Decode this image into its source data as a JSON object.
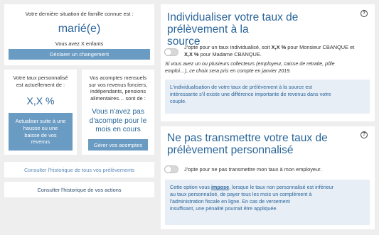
{
  "family": {
    "heading": "Votre dernière situation de famille connue est :",
    "status": "marié(e)",
    "children": "Vous avez X enfants",
    "declare_button": "Déclarer un changement"
  },
  "rate": {
    "heading_line1": "Votre taux personnalisé",
    "heading_line2": "est actuellement de :",
    "value": "X,X %",
    "button_line1": "Actualiser suite à une",
    "button_line2": "hausse ou une",
    "button_line3": "baisse de vos",
    "button_line4": "revenus"
  },
  "installments": {
    "heading_line1": "Vos acomptes mensuels",
    "heading_line2": "sur vos revenus fonciers,",
    "heading_line3": "indépendants, pensions",
    "heading_line4": "alimentaires… sont de :",
    "message_line1": "Vous n'avez pas",
    "message_line2": "d'acompte pour le",
    "message_line3": "mois en cours",
    "button": "Gérer vos acomptes"
  },
  "links": {
    "history_withholding": "Consulter l'historique de tous vos prélèvements",
    "history_actions": "Consulter l'historique de vos actions"
  },
  "individualize": {
    "title_line1": "Individualiser votre taux de prélèvement à la",
    "title_line2": "source",
    "help": "?",
    "option_pre": "J'opte pour un taux individualisé, soit ",
    "rate1": "X,X %",
    "option_mid": " pour Monsieur CBANQUE et",
    "rate2": "X,X %",
    "option_post": " pour Madame CBANQUE.",
    "note_line1": "Si vous avez un ou plusieurs collecteurs (employeur, caisse de retraite, pôle",
    "note_line2": "emploi…), ce choix sera pris en compte en janvier 2019.",
    "info_line1": "L'individualisation de votre taux de prélèvement à la source est",
    "info_line2": "intéressante s'il existe une différence importante de revenus dans votre",
    "info_line3": "couple."
  },
  "no_transmit": {
    "title_line1": "Ne pas transmettre votre taux de",
    "title_line2": "prélèvement personnalisé",
    "help": "?",
    "option": "J'opte pour ne pas transmettre mon taux à mon employeur.",
    "info_pre": "Cette option vous ",
    "info_link": "impose",
    "info_post": ", lorsque le taux non personnalisé est inférieur",
    "info_line2": "au taux personnalisé, de payer tous les mois un complément à",
    "info_line3": "l'administration fiscale en ligne. En cas de versement",
    "info_line4": "insuffisant, une pénalité pourrait être appliquée."
  },
  "colors": {
    "accent": "#2a6599",
    "button": "#6a9bc3",
    "info_bg": "#e7eef6",
    "page_bg": "#eeeeee"
  }
}
